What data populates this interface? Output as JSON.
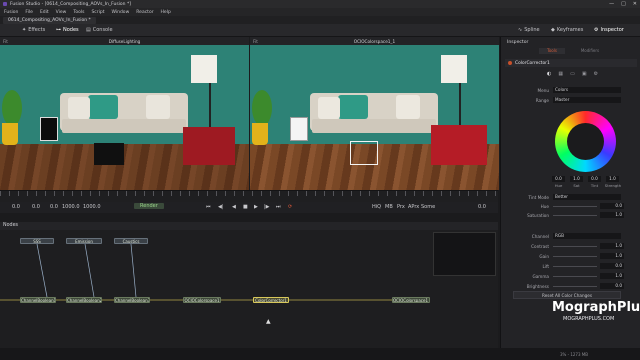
{
  "window": {
    "title": "Fusion Studio - [0614_Compositing_AOVs_In_Fusion *]",
    "min": "—",
    "max": "□",
    "close": "✕"
  },
  "menu": [
    "Fusion",
    "File",
    "Edit",
    "View",
    "Tools",
    "Script",
    "Window",
    "Reactor",
    "Help"
  ],
  "file_tab": "0614_Compositing_AOVs_In_Fusion *",
  "toolbar": {
    "effects": "Effects",
    "nodes": "Nodes",
    "console": "Console",
    "spline": "Spline",
    "keyframes": "Keyframes",
    "inspector": "Inspector"
  },
  "viewer_left": {
    "name": "DiffuseLighting",
    "res": "1920x1080xfloat16",
    "ctrl": "Fit"
  },
  "viewer_right": {
    "name": "OCIOColorspace1_1",
    "res": "1920x1080xfloat16",
    "ctrl": "Fit"
  },
  "transport": {
    "start": "0.0",
    "zero": "0.0",
    "pos": "0.0",
    "end": "1000.0",
    "render_end": "1000.0",
    "render": "Render",
    "hiq": "HiQ",
    "mb": "MB",
    "prx": "Prx",
    "aprx": "APrx",
    "some": "Some",
    "current": "0.0"
  },
  "nodes": {
    "header": "Nodes",
    "list": [
      {
        "id": "sss",
        "label": "SSS",
        "kind": "src"
      },
      {
        "id": "emission",
        "label": "Emission",
        "kind": "src"
      },
      {
        "id": "caustics",
        "label": "Caustics",
        "kind": "src"
      },
      {
        "id": "cb1",
        "label": "ChannelBoolean1",
        "kind": "op"
      },
      {
        "id": "cb2",
        "label": "ChannelBoolean2",
        "kind": "op"
      },
      {
        "id": "cb3",
        "label": "ChannelBoolean3",
        "kind": "op"
      },
      {
        "id": "ocio1",
        "label": "OCIOColorspace1",
        "kind": "op"
      },
      {
        "id": "cc1",
        "label": "ColorCorrector1",
        "kind": "sel"
      },
      {
        "id": "ocio2",
        "label": "OCIOColorspace1_1",
        "kind": "op"
      }
    ]
  },
  "inspector": {
    "tabs": [
      "Tools",
      "Modifiers"
    ],
    "tool_name": "ColorCorrector1",
    "menu_label": "Menu",
    "menu_value": "Colors",
    "range_label": "Range",
    "range_value": "Master",
    "wheel_values": [
      "0.0",
      "1.0",
      "0.0",
      "1.0"
    ],
    "wheel_labels": [
      "Hue",
      "Sat",
      "Tint",
      "Strength"
    ],
    "tint_mode_label": "Tint Mode",
    "tint_mode_value": "Better",
    "hue_label": "Hue",
    "hue_value": "0.0",
    "saturation_label": "Saturation",
    "saturation_value": "1.0",
    "channel_label": "Channel",
    "channel_value": "RGB",
    "contrast_label": "Contrast",
    "contrast_value": "1.0",
    "gain_label": "Gain",
    "gain_value": "1.0",
    "lift_label": "Lift",
    "lift_value": "0.0",
    "gamma_label": "Gamma",
    "gamma_value": "1.0",
    "brightness_label": "Brightness",
    "brightness_value": "0.0",
    "reset": "Reset All Color Changes"
  },
  "watermark": {
    "main": "MographPlus",
    "sub": "MOGRAPHPLUS.COM"
  },
  "status": {
    "left": "",
    "right": "3% - 1273 MB"
  },
  "colors": {
    "wall": "#2d8276",
    "accent": "#d8c85a",
    "bg": "#1b1b1d"
  }
}
